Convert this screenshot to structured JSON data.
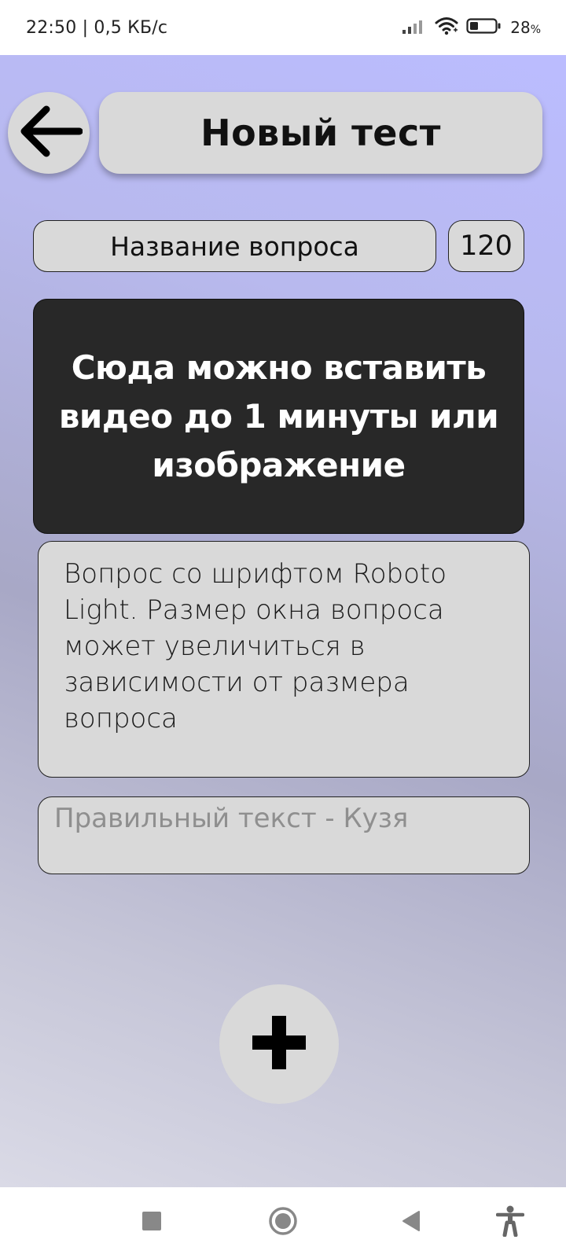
{
  "status_bar": {
    "time_speed": "22:50 | 0,5 КБ/с",
    "battery_percent": "28",
    "battery_unit": "%",
    "battery_level": 0.28,
    "icons": [
      "signal-icon",
      "wifi-icon",
      "battery-icon"
    ]
  },
  "header": {
    "back_icon": "arrow-left-icon",
    "title": "Новый тест"
  },
  "question_row": {
    "name_label": "Название вопроса",
    "timer_value": "120"
  },
  "media": {
    "placeholder_text": "Сюда можно вставить видео до 1 минуты или изображение"
  },
  "question": {
    "text": "Вопрос со шрифтом Roboto Light. Размер окна вопроса может увеличиться в зависимости от размера вопроса"
  },
  "answer": {
    "placeholder": "Правильный текст - Кузя"
  },
  "add_button": {
    "icon": "plus-icon"
  },
  "nav_bar": {
    "items": [
      "recents-square-icon",
      "home-circle-icon",
      "back-triangle-icon",
      "accessibility-icon"
    ]
  },
  "colors": {
    "card_bg": "#d9d9d9",
    "media_bg": "#282828",
    "gradient_top": "#bbbcff",
    "gradient_bottom": "#dadae6"
  }
}
